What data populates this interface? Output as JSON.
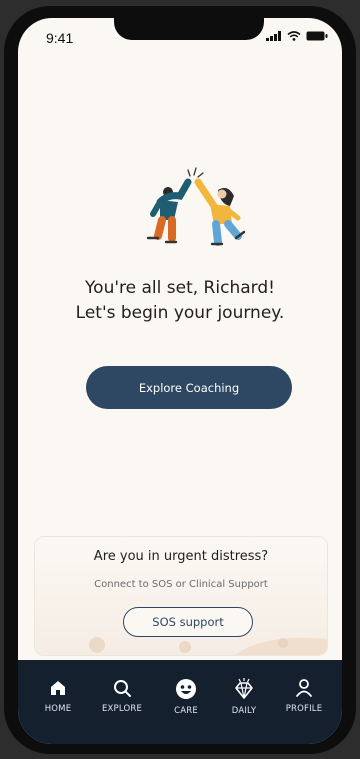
{
  "status_bar": {
    "time": "9:41"
  },
  "onboarding": {
    "headline_line1": "You're all set, Richard!",
    "headline_line2": "Let's begin your journey.",
    "cta_label": "Explore Coaching"
  },
  "sos": {
    "title": "Are you in urgent distress?",
    "subtitle": "Connect to SOS or Clinical Support",
    "button_label": "SOS support"
  },
  "nav": {
    "items": [
      {
        "label": "HOME",
        "icon": "home-icon"
      },
      {
        "label": "EXPLORE",
        "icon": "search-icon"
      },
      {
        "label": "CARE",
        "icon": "care-icon"
      },
      {
        "label": "DAILY",
        "icon": "diamond-icon"
      },
      {
        "label": "PROFILE",
        "icon": "person-icon"
      }
    ]
  },
  "colors": {
    "primary": "#2e4763",
    "nav_bg": "#15202f",
    "screen_bg": "#fbf8f3"
  }
}
